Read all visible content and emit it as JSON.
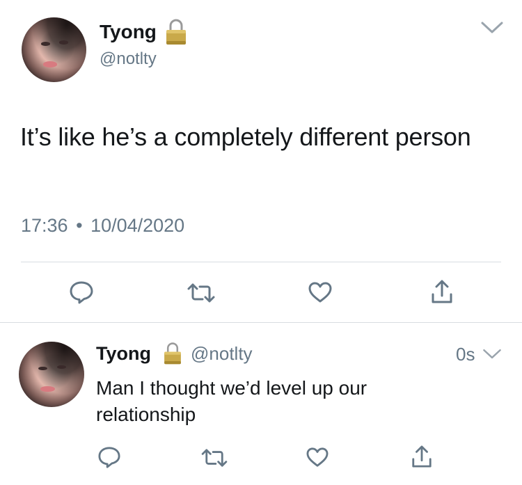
{
  "main_tweet": {
    "author_name": "Tyong",
    "author_handle": "@notlty",
    "text": "It’s like he’s a completely different person",
    "time": "17:36",
    "separator": "•",
    "date": "10/04/2020",
    "icons": {
      "lock": "lock-icon",
      "menu": "chevron-down-icon",
      "reply": "reply-icon",
      "retweet": "retweet-icon",
      "like": "heart-icon",
      "share": "share-icon"
    }
  },
  "reply_tweet": {
    "author_name": "Tyong",
    "author_handle": "@notlty",
    "time": "0s",
    "text": "Man I thought we’d level up our relationship"
  },
  "colors": {
    "text": "#14171a",
    "secondary": "#657786",
    "divider": "#d8dde1",
    "lock_gold": "#c9a94a"
  }
}
